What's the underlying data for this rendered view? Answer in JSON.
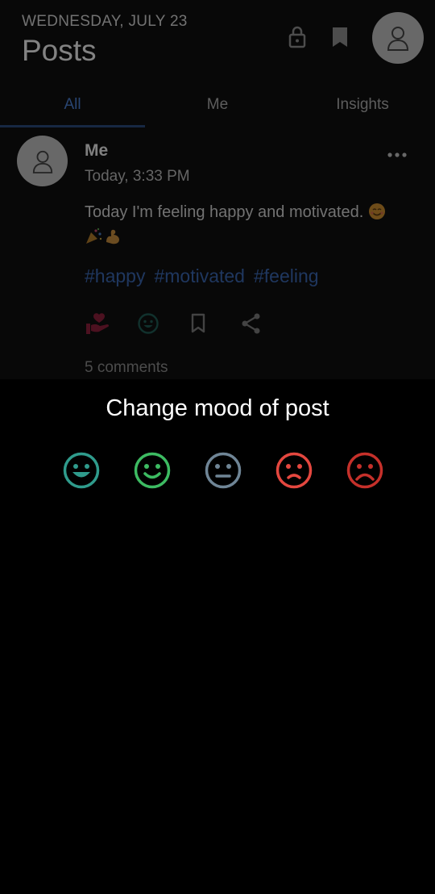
{
  "header": {
    "date": "WEDNESDAY, JULY 23",
    "title": "Posts",
    "icons": [
      "lock-icon",
      "bookmark-icon",
      "avatar-icon"
    ]
  },
  "tabs": [
    {
      "label": "All",
      "active": true
    },
    {
      "label": "Me",
      "active": false
    },
    {
      "label": "Insights",
      "active": false
    }
  ],
  "post": {
    "author": "Me",
    "time": "Today, 3:33 PM",
    "text": "Today I'm feeling happy and motivated.",
    "tags": [
      "#happy",
      "#motivated",
      "#feeling"
    ],
    "comments": "5 comments",
    "actions": [
      "heart-hand-icon",
      "mood-icon",
      "bookmark-icon",
      "share-icon"
    ]
  },
  "mood_dialog": {
    "title": "Change mood of post",
    "moods": [
      {
        "name": "very-happy",
        "color": "#2f9b8c"
      },
      {
        "name": "happy",
        "color": "#3dbb62"
      },
      {
        "name": "neutral",
        "color": "#6f8596"
      },
      {
        "name": "sad",
        "color": "#e4473f"
      },
      {
        "name": "very-sad",
        "color": "#c5302a"
      }
    ]
  },
  "colors": {
    "accent": "#4b7fd0",
    "tag": "#3a64ad",
    "background": "#000000"
  }
}
